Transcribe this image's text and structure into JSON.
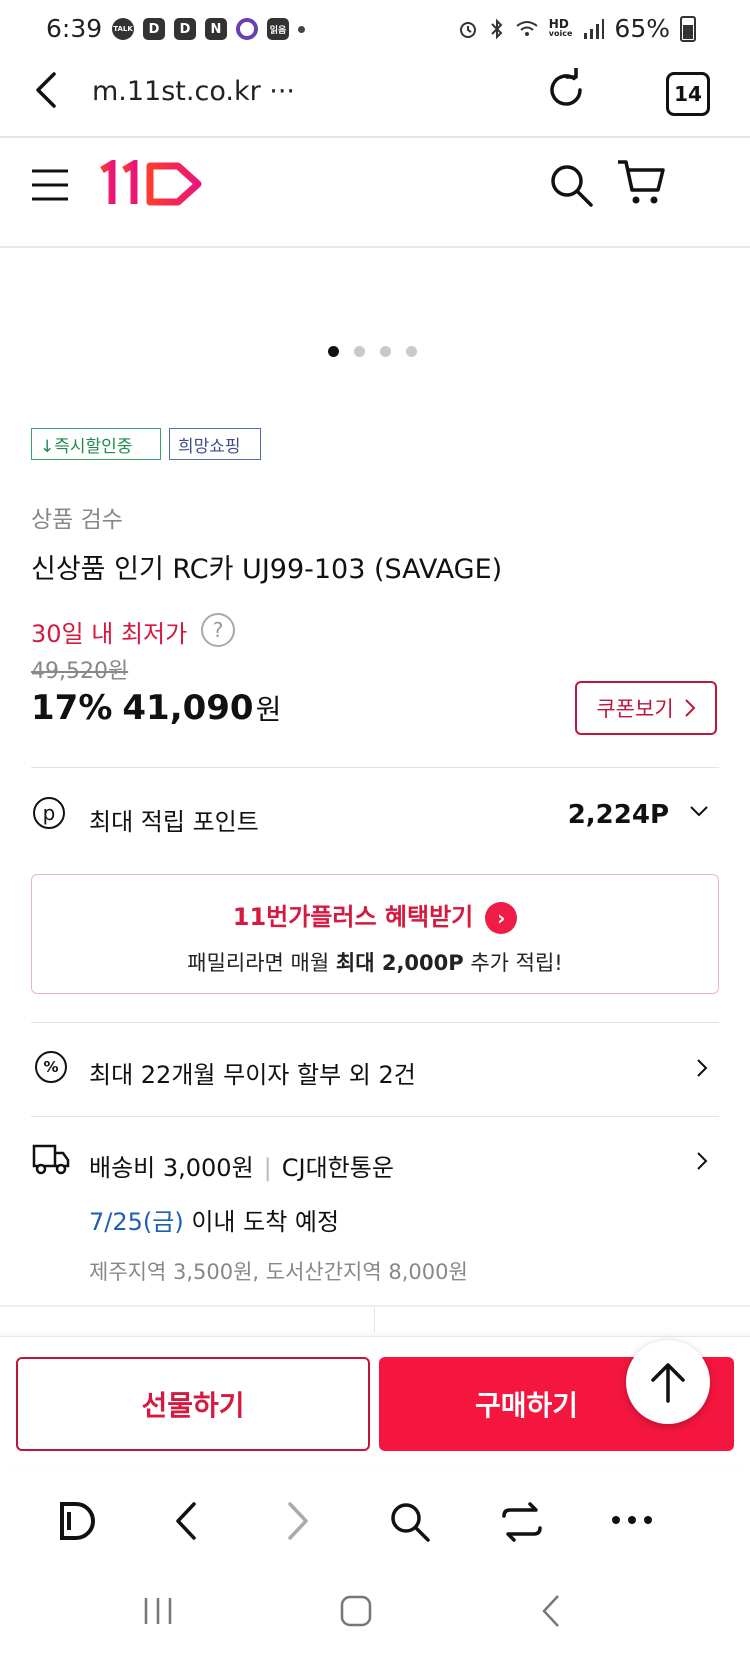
{
  "status_bar": {
    "time": "6:39",
    "apps": [
      "TALK",
      "D",
      "D",
      "N",
      "",
      "읽음"
    ],
    "network": "HD",
    "network_sub": "voice",
    "battery": "65%"
  },
  "browser": {
    "url": "m.11st.co.kr ···",
    "tab_count": "14"
  },
  "site": {
    "logo_text": "11",
    "brand_color": "#f4163f"
  },
  "carousel": {
    "count": 4,
    "active_index": 0
  },
  "tags": [
    "↓즉시할인중",
    "희망쇼핑"
  ],
  "product": {
    "subtitle": "상품 검수",
    "title": "신상품 인기 RC카 UJ99-103 (SAVAGE)",
    "lowest_label": "30일 내 최저가",
    "help_icon_text": "?",
    "original_price": "49,520원",
    "discount": "17%",
    "price": "41,090",
    "currency": "원",
    "coupon_label": "쿠폰보기"
  },
  "points": {
    "icon_text": "p",
    "label": "최대 적립 포인트",
    "value": "2,224P"
  },
  "plus_banner": {
    "title": "11번가플러스 혜택받기",
    "desc_prefix": "패밀리라면 매월 ",
    "desc_bold": "최대 2,000P",
    "desc_suffix": " 추가 적립!"
  },
  "installment": {
    "icon_text": "%",
    "label": "최대 22개월 무이자 할부 외 2건"
  },
  "shipping": {
    "fee": "배송비 3,000원",
    "carrier": "CJ대한통운",
    "date": "7/25(금)",
    "date_suffix": " 이내 도착 예정",
    "extra": "제주지역 3,500원, 도서산간지역 8,000원"
  },
  "actions": {
    "gift_label": "선물하기",
    "buy_label": "구매하기"
  },
  "browser_nav": {
    "icons": [
      "d-logo-icon",
      "back-icon",
      "forward-icon",
      "search-icon",
      "tabs-icon",
      "more-icon"
    ]
  },
  "system_nav": {
    "icons": [
      "recents-icon",
      "home-icon",
      "back-icon"
    ]
  }
}
